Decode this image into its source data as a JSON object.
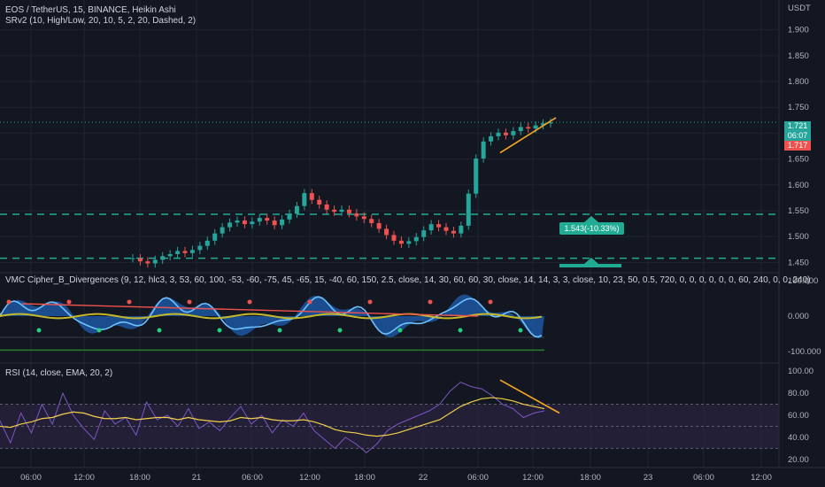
{
  "header": {
    "symbol_line": "EOS / TetherUS, 15, BINANCE, Heikin Ashi",
    "indicator_srv2": "SRv2 (10, High/Low, 20, 10, 5, 2, 20, Dashed, 2)"
  },
  "vmc_legend": "VMC Cipher_B_Divergences (9, 12, hlc3, 3, 53, 60, 100, -53, -60, -75, 45, -65, 15, -40, 60, 150, 2.5, close, 14, 30, 60, 60, 30, close, 14, 14, 3, 3, close, 10, 23, 50, 0.5, 720, 0, 0, 0, 0, 0, 0, 60, 240, 0, 0, 240)",
  "rsi_legend": "RSI (14, close, EMA, 20, 2)",
  "price_axis": {
    "currency": "USDT",
    "ticks": [
      "1.900",
      "1.850",
      "1.800",
      "1.750",
      "1.700",
      "1.650",
      "1.600",
      "1.550",
      "1.500",
      "1.450"
    ]
  },
  "price_tags": {
    "last_price": "1.721",
    "countdown": "06:07",
    "low_price": "1.717"
  },
  "sr_label": "1.543(-10.33%)",
  "vmc_axis": [
    "100.000",
    "0.000",
    "-100.000"
  ],
  "rsi_axis": [
    "100.00",
    "80.00",
    "60.00",
    "40.00",
    "20.00"
  ],
  "time_axis": [
    "06:00",
    "12:00",
    "18:00",
    "21",
    "06:00",
    "12:00",
    "18:00",
    "22",
    "06:00",
    "12:00",
    "18:00",
    "23",
    "06:00",
    "12:00"
  ],
  "colors": {
    "background": "#131722",
    "bull": "#26a69a",
    "bear": "#ef5350",
    "sr_line": "#22ab94",
    "trend": "#f5a623",
    "rsi_line": "#7e57c2",
    "rsi_ma": "#f2d04b",
    "rsi_band": "#2a2440"
  },
  "chart_data": [
    {
      "type": "candlestick",
      "title": "EOS / TetherUS, 15, BINANCE, Heikin Ashi",
      "ylim": [
        1.43,
        1.92
      ],
      "support_resistance": [
        1.543,
        1.458
      ],
      "close_series": [
        1.458,
        1.452,
        1.448,
        1.455,
        1.462,
        1.466,
        1.472,
        1.468,
        1.474,
        1.482,
        1.492,
        1.506,
        1.518,
        1.527,
        1.531,
        1.524,
        1.529,
        1.536,
        1.531,
        1.522,
        1.533,
        1.544,
        1.559,
        1.584,
        1.571,
        1.562,
        1.552,
        1.548,
        1.552,
        1.545,
        1.539,
        1.534,
        1.526,
        1.515,
        1.503,
        1.492,
        1.486,
        1.491,
        1.499,
        1.512,
        1.524,
        1.518,
        1.511,
        1.506,
        1.521,
        1.583,
        1.651,
        1.684,
        1.694,
        1.701,
        1.696,
        1.704,
        1.712,
        1.709,
        1.715,
        1.719,
        1.721
      ]
    },
    {
      "type": "line",
      "title": "RSI (14, close, EMA, 20, 2)",
      "ylim": [
        15,
        105
      ],
      "bands": [
        70,
        30
      ],
      "series": [
        {
          "name": "RSI",
          "values": [
            55,
            35,
            62,
            44,
            70,
            52,
            80,
            60,
            48,
            38,
            64,
            52,
            58,
            42,
            72,
            56,
            60,
            50,
            66,
            48,
            54,
            46,
            58,
            68,
            52,
            60,
            44,
            56,
            50,
            62,
            46,
            38,
            30,
            40,
            34,
            26,
            34,
            46,
            52,
            56,
            60,
            64,
            70,
            82,
            90,
            86,
            84,
            78,
            70,
            66,
            58,
            62,
            64
          ]
        },
        {
          "name": "EMA",
          "values": [
            50,
            49,
            52,
            54,
            57,
            58,
            61,
            63,
            62,
            59,
            57,
            57,
            58,
            56,
            57,
            58,
            58,
            56,
            58,
            56,
            55,
            54,
            55,
            58,
            57,
            58,
            56,
            55,
            55,
            56,
            54,
            51,
            47,
            45,
            44,
            42,
            41,
            42,
            44,
            47,
            50,
            53,
            56,
            62,
            68,
            72,
            75,
            76,
            75,
            73,
            70,
            68,
            66
          ]
        }
      ]
    }
  ]
}
